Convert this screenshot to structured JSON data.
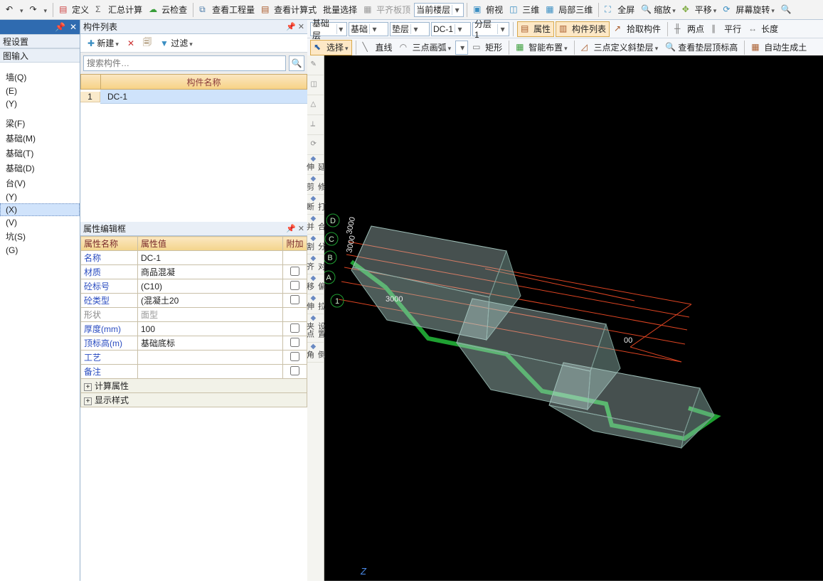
{
  "topbar": {
    "define": "定义",
    "sumcalc": "汇总计算",
    "cloudcheck": "云检查",
    "viewqty": "查看工程量",
    "viewexpr": "查看计算式",
    "batchsel": "批量选择",
    "flattop": "平齐板顶",
    "curfloor": "当前楼层",
    "overlook": "俯视",
    "threeD": "三维",
    "local3d": "局部三维",
    "fullscr": "全屏",
    "zoom": "缩放",
    "pan": "平移",
    "rotate": "屏幕旋转"
  },
  "sb": {
    "basicfloor": "基础层",
    "basic": "基础",
    "cushion": "垫层",
    "dc1": "DC-1",
    "layer1": "分层1",
    "attr": "属性",
    "complist": "构件列表",
    "pick": "拾取构件",
    "twopt": "两点",
    "parallel": "平行",
    "length": "长度",
    "select": "选择",
    "line": "直线",
    "arc3pt": "三点画弧",
    "rect": "矩形",
    "smartarr": "智能布置",
    "slope3pt": "三点定义斜垫层",
    "viewcushtop": "查看垫层顶标高",
    "autogensoil": "自动生成土"
  },
  "left": {
    "header": "",
    "sect1": "程设置",
    "sect2": "图输入",
    "items": [
      "",
      "",
      "墙(Q)",
      "(E)",
      "(Y)",
      "",
      "",
      "梁(F)",
      "基础(M)",
      "基础(T)",
      "基础(D)",
      "台(V)",
      "(Y)",
      "(X)",
      "(V)",
      "坑(S)",
      "(G)",
      "",
      ""
    ]
  },
  "complist": {
    "title": "构件列表",
    "new": "新建",
    "filter": "过滤",
    "search_ph": "搜索构件…",
    "col_name": "构件名称",
    "row1": "DC-1"
  },
  "prop": {
    "title": "属性编辑框",
    "h_name": "属性名称",
    "h_val": "属性值",
    "h_add": "附加",
    "rows": [
      {
        "name": "名称",
        "val": "DC-1",
        "add": false,
        "link": true
      },
      {
        "name": "材质",
        "val": "商品混凝",
        "add": false,
        "link": true,
        "cb": true
      },
      {
        "name": "砼标号",
        "val": "(C10)",
        "add": false,
        "link": true,
        "cb": true
      },
      {
        "name": "砼类型",
        "val": "(混凝土20",
        "add": false,
        "link": true,
        "cb": true
      },
      {
        "name": "形状",
        "val": "面型",
        "add": false,
        "dis": true
      },
      {
        "name": "厚度(mm)",
        "val": "100",
        "add": false,
        "link": true,
        "cb": true
      },
      {
        "name": "顶标高(m)",
        "val": "基础底标",
        "add": false,
        "cb": true
      },
      {
        "name": "工艺",
        "val": "",
        "add": false,
        "link": true,
        "cb": true
      },
      {
        "name": "备注",
        "val": "",
        "add": false,
        "link": true,
        "cb": true
      }
    ],
    "grp1": "计算属性",
    "grp2": "显示样式"
  },
  "vtools": [
    "",
    "",
    "",
    "",
    "",
    "延伸",
    "修剪",
    "打断",
    "合并",
    "分割",
    "对齐",
    "偏移",
    "拉伸",
    "设置夹点",
    "倒角"
  ],
  "scene": {
    "labels": [
      "D",
      "C",
      "B",
      "A",
      "1"
    ],
    "dims": [
      "3000",
      "3000",
      "3000"
    ],
    "axis": "Z"
  }
}
